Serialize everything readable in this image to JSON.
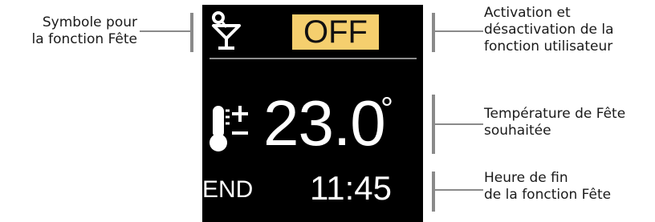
{
  "display": {
    "status": "OFF",
    "temperature": "23.0",
    "degree_symbol": "°",
    "end_label": "END",
    "end_time": "11:45"
  },
  "callouts": {
    "symbol": "Symbole pour\nla fonction Fête",
    "toggle": "Activation et\ndésactivation de la\nfonction utilisateur",
    "temperature": "Température de Fête\nsouhaitée",
    "end_time": "Heure de fin\nde la fonction Fête"
  },
  "colors": {
    "screen": "#000000",
    "badge": "#f5cf6e",
    "line": "#8a8a8a",
    "text_on_screen": "#ffffff"
  },
  "icons": [
    "cocktail-glass-icon",
    "thermometer-adjust-icon"
  ]
}
